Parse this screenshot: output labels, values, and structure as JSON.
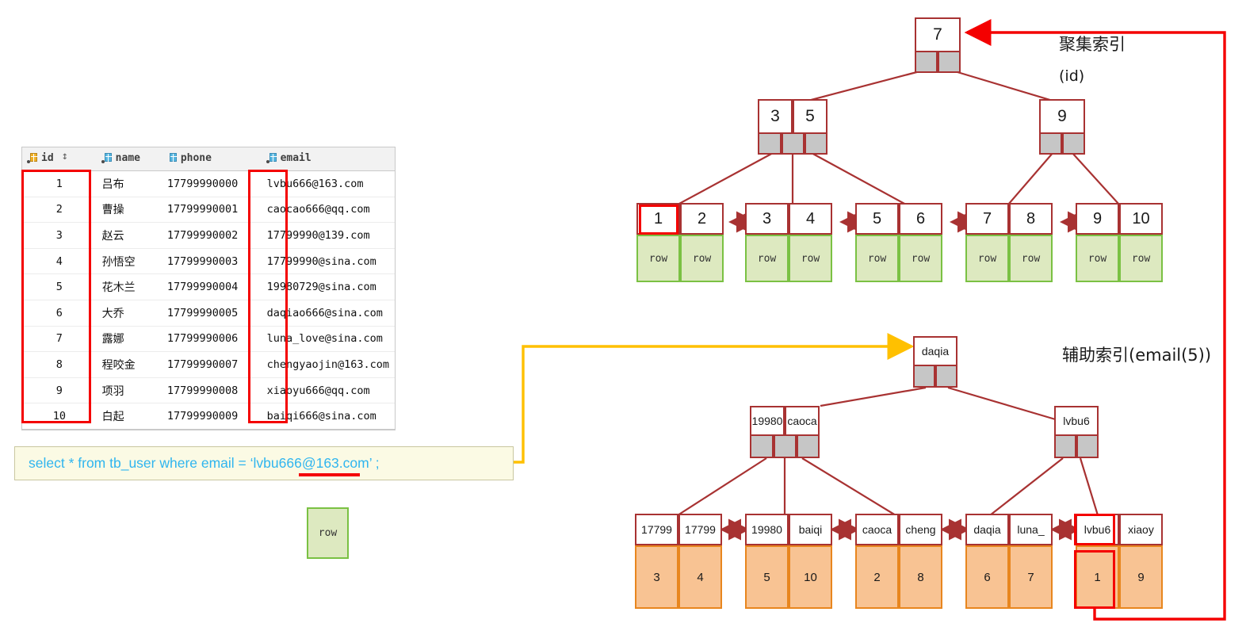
{
  "table": {
    "name": "tb_user-result-table",
    "columns": [
      {
        "key": "id",
        "label": "id",
        "icon": "primary-key-column-icon",
        "sortable": true,
        "sort_glyph": "↕"
      },
      {
        "key": "name",
        "label": "name",
        "icon": "column-icon"
      },
      {
        "key": "phone",
        "label": "phone",
        "icon": "column-icon"
      },
      {
        "key": "email",
        "label": "email",
        "icon": "column-icon"
      }
    ],
    "rows": [
      {
        "id": "1",
        "name": "吕布",
        "phone": "17799990000",
        "email": "lvbu666@163.com"
      },
      {
        "id": "2",
        "name": "曹操",
        "phone": "17799990001",
        "email": "caocao666@qq.com"
      },
      {
        "id": "3",
        "name": "赵云",
        "phone": "17799990002",
        "email": "17799990@139.com"
      },
      {
        "id": "4",
        "name": "孙悟空",
        "phone": "17799990003",
        "email": "17799990@sina.com"
      },
      {
        "id": "5",
        "name": "花木兰",
        "phone": "17799990004",
        "email": "19980729@sina.com"
      },
      {
        "id": "6",
        "name": "大乔",
        "phone": "17799990005",
        "email": "daqiao666@sina.com"
      },
      {
        "id": "7",
        "name": "露娜",
        "phone": "17799990006",
        "email": "luna_love@sina.com"
      },
      {
        "id": "8",
        "name": "程咬金",
        "phone": "17799990007",
        "email": "chengyaojin@163.com"
      },
      {
        "id": "9",
        "name": "项羽",
        "phone": "17799990008",
        "email": "xiaoyu666@qq.com"
      },
      {
        "id": "10",
        "name": "白起",
        "phone": "17799990009",
        "email": "baiqi666@sina.com"
      }
    ]
  },
  "sql": {
    "statement": "select * from tb_user where email = ‘lvbu666@163.com’ ;"
  },
  "labels": {
    "clustered_index": "聚集索引",
    "clustered_index_key": "(id)",
    "secondary_index": "辅助索引(email(5))"
  },
  "clustered_index": {
    "root": {
      "keys": [
        "7"
      ],
      "pointers": 2
    },
    "level2": [
      {
        "keys": [
          "3",
          "5"
        ],
        "pointers": 3
      },
      {
        "keys": [
          "9"
        ],
        "pointers": 2
      }
    ],
    "leaves": [
      {
        "keys": [
          "1",
          "2"
        ],
        "rows": [
          "row",
          "row"
        ]
      },
      {
        "keys": [
          "3",
          "4"
        ],
        "rows": [
          "row",
          "row"
        ]
      },
      {
        "keys": [
          "5",
          "6"
        ],
        "rows": [
          "row",
          "row"
        ]
      },
      {
        "keys": [
          "7",
          "8"
        ],
        "rows": [
          "row",
          "row"
        ]
      },
      {
        "keys": [
          "9",
          "10"
        ],
        "rows": [
          "row",
          "row"
        ]
      }
    ],
    "highlighted_leaf_key": "1"
  },
  "secondary_index": {
    "root": {
      "keys": [
        "daqia"
      ],
      "pointers": 2
    },
    "level2": [
      {
        "keys": [
          "19980",
          "caoca"
        ],
        "pointers": 3
      },
      {
        "keys": [
          "lvbu6"
        ],
        "pointers": 2
      }
    ],
    "leaves": [
      {
        "keys": [
          "17799",
          "17799"
        ],
        "ids": [
          "3",
          "4"
        ]
      },
      {
        "keys": [
          "19980",
          "baiqi"
        ],
        "ids": [
          "5",
          "10"
        ]
      },
      {
        "keys": [
          "caoca",
          "cheng"
        ],
        "ids": [
          "2",
          "8"
        ]
      },
      {
        "keys": [
          "daqia",
          "luna_"
        ],
        "ids": [
          "6",
          "7"
        ]
      },
      {
        "keys": [
          "lvbu6",
          "xiaoy"
        ],
        "ids": [
          "1",
          "9"
        ]
      }
    ],
    "highlighted_leaf_key": "lvbu6",
    "highlighted_leaf_id": "1"
  },
  "standalone_row_box": {
    "label": "row"
  },
  "colors": {
    "node_border": "#a83232",
    "pointer_fill": "#c6c6c6",
    "row_fill": "#dde9c0",
    "row_border": "#7ac143",
    "id_fill": "#f8c393",
    "id_border": "#e8861e",
    "highlight_red": "#f40000",
    "yellow_arrow": "#ffc000",
    "sql_text": "#2fb5ef",
    "sql_bg": "#fbfae4"
  }
}
